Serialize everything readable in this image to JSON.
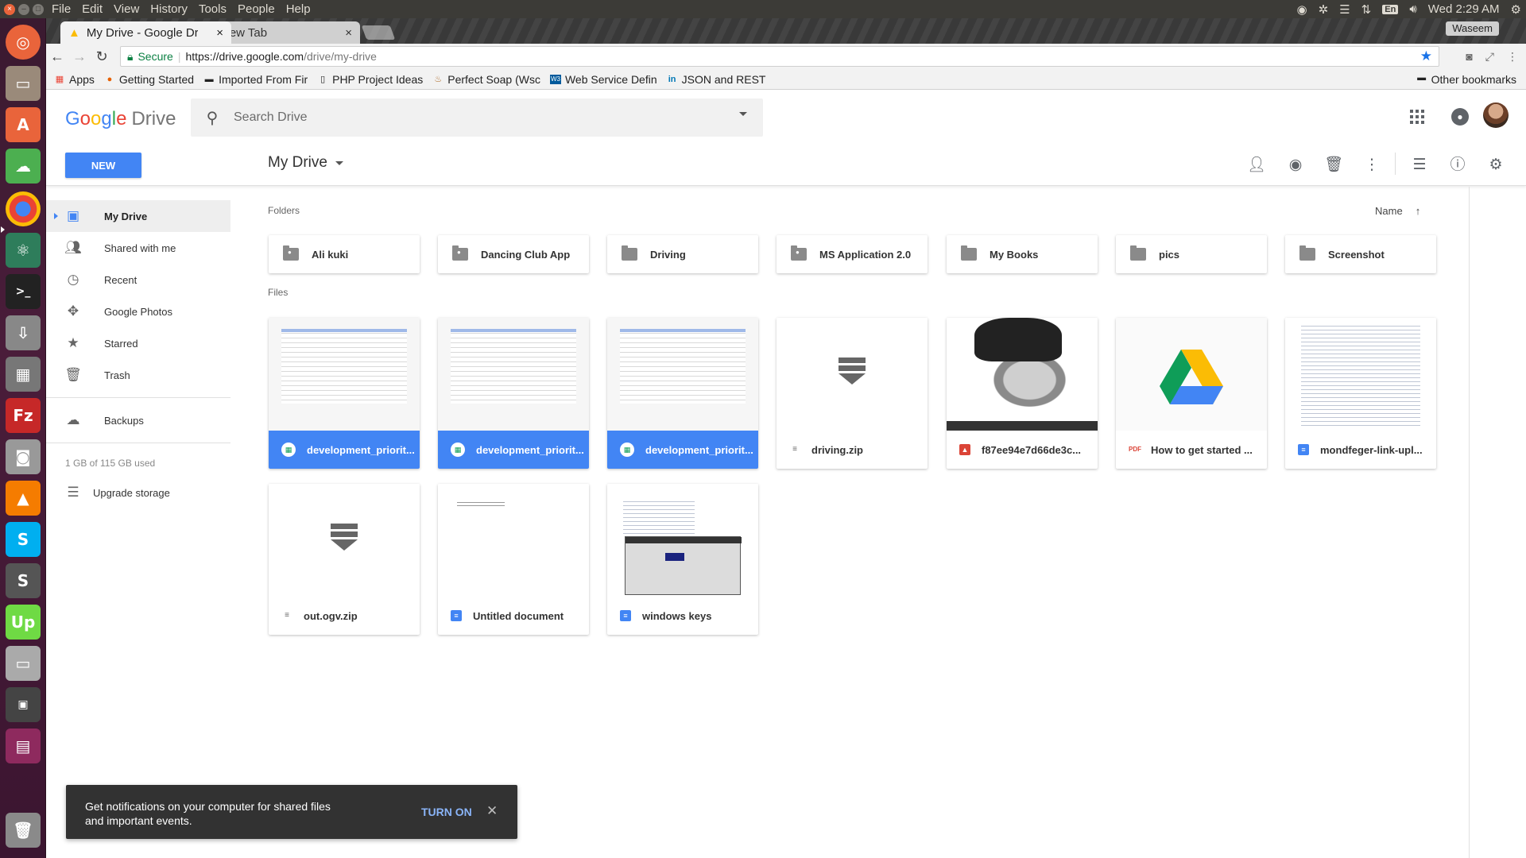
{
  "os_menu": [
    "File",
    "Edit",
    "View",
    "History",
    "Tools",
    "People",
    "Help"
  ],
  "os_status": {
    "lang": "En",
    "clock": "Wed 2:29 AM"
  },
  "browser": {
    "tabs": [
      {
        "title": "My Drive - Google Dr"
      },
      {
        "title": "New Tab"
      }
    ],
    "profile": "Waseem",
    "secure_label": "Secure",
    "url_host": "https://drive.google.com",
    "url_path": "/drive/my-drive",
    "bookmarks": [
      "Apps",
      "Getting Started",
      "Imported From Fir",
      "PHP Project Ideas",
      "Perfect Soap (Wsc",
      "Web Service Defin",
      "JSON and REST"
    ],
    "other_bookmarks": "Other bookmarks"
  },
  "drive": {
    "logo_google": "Google",
    "logo_drive": "Drive",
    "search_placeholder": "Search Drive",
    "new_button": "NEW",
    "breadcrumb": "My Drive",
    "sidebar": {
      "items": [
        {
          "label": "My Drive",
          "icon": "drive-icon",
          "selected": true
        },
        {
          "label": "Shared with me",
          "icon": "people-icon"
        },
        {
          "label": "Recent",
          "icon": "clock-icon"
        },
        {
          "label": "Google Photos",
          "icon": "pinwheel-icon"
        },
        {
          "label": "Starred",
          "icon": "star-icon"
        },
        {
          "label": "Trash",
          "icon": "trash-icon"
        }
      ],
      "backups": "Backups",
      "quota": "1 GB of 115 GB used",
      "upgrade": "Upgrade storage"
    },
    "folders_label": "Folders",
    "files_label": "Files",
    "sort_label": "Name",
    "folders": [
      {
        "name": "Ali kuki",
        "shared": true
      },
      {
        "name": "Dancing Club App",
        "shared": true
      },
      {
        "name": "Driving",
        "shared": false
      },
      {
        "name": "MS Application 2.0",
        "shared": true
      },
      {
        "name": "My Books",
        "shared": false
      },
      {
        "name": "pics",
        "shared": false
      },
      {
        "name": "Screenshot",
        "shared": false
      }
    ],
    "files": [
      {
        "name": "development_priorit...",
        "type": "sheet",
        "selected": true
      },
      {
        "name": "development_priorit...",
        "type": "sheet",
        "selected": true
      },
      {
        "name": "development_priorit...",
        "type": "sheet",
        "selected": true
      },
      {
        "name": "driving.zip",
        "type": "zip",
        "selected": false
      },
      {
        "name": "f87ee94e7d66de3c...",
        "type": "image",
        "selected": false
      },
      {
        "name": "How to get started ...",
        "type": "pdf",
        "selected": false
      },
      {
        "name": "mondfeger-link-upl...",
        "type": "doc",
        "selected": false
      },
      {
        "name": "out.ogv.zip",
        "type": "zip",
        "selected": false
      },
      {
        "name": "Untitled document",
        "type": "doc",
        "selected": false
      },
      {
        "name": "windows keys",
        "type": "doc",
        "selected": false
      }
    ],
    "pdf_badge": "PDF",
    "snackbar": {
      "message": "Get notifications on your computer for shared files and important events.",
      "action": "TURN ON"
    }
  }
}
